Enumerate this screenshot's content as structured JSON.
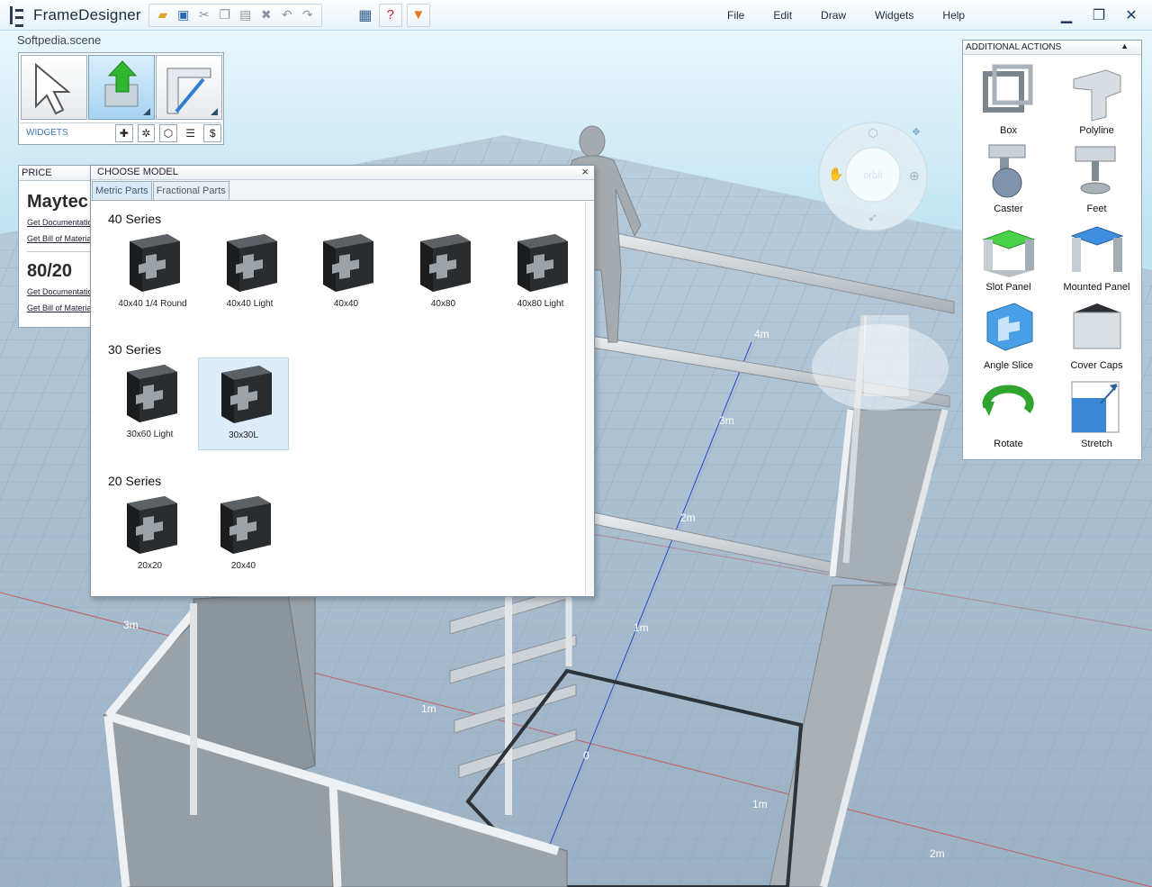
{
  "app": {
    "title": "FrameDesigner",
    "scene_name": "Softpedia.scene"
  },
  "menu": [
    "File",
    "Edit",
    "Draw",
    "Widgets",
    "Help"
  ],
  "widgets": {
    "label": "WIDGETS"
  },
  "price_panel": {
    "header": "PRICE",
    "vendors": [
      {
        "name": "Maytec",
        "links": [
          "Get Documentation",
          "Get Bill of Materials"
        ]
      },
      {
        "name": "80/20",
        "links": [
          "Get Documentation",
          "Get Bill of Materials"
        ]
      }
    ]
  },
  "choose_model": {
    "title": "CHOOSE MODEL",
    "close": "×",
    "tabs": [
      "Metric Parts",
      "Fractional Parts"
    ],
    "active_tab": "Metric Parts",
    "series": [
      {
        "title": "40 Series",
        "parts": [
          "40x40 1/4 Round",
          "40x40 Light",
          "40x40",
          "40x80",
          "40x80 Light"
        ]
      },
      {
        "title": "30 Series",
        "parts": [
          "30x60 Light",
          "30x30L"
        ]
      },
      {
        "title": "20 Series",
        "parts": [
          "20x20",
          "20x40"
        ]
      }
    ],
    "selected_part": "30x30L"
  },
  "additional_actions": {
    "title": "ADDITIONAL ACTIONS",
    "collapse": "▲",
    "items": [
      "Box",
      "Polyline",
      "Caster",
      "Feet",
      "Slot Panel",
      "Mounted Panel",
      "Angle Slice",
      "Cover Caps",
      "Rotate",
      "Stretch"
    ]
  },
  "nav_wheel": {
    "label": "orbit"
  },
  "scene_labels": {
    "dims": [
      "4m",
      "3m",
      "2m",
      "1m",
      "0",
      "1m",
      "2m",
      "3m",
      "1m"
    ]
  },
  "colors": {
    "accent_blue": "#3a7bc2",
    "grid": "#7d96ad",
    "floor": "#9fb6c9"
  }
}
